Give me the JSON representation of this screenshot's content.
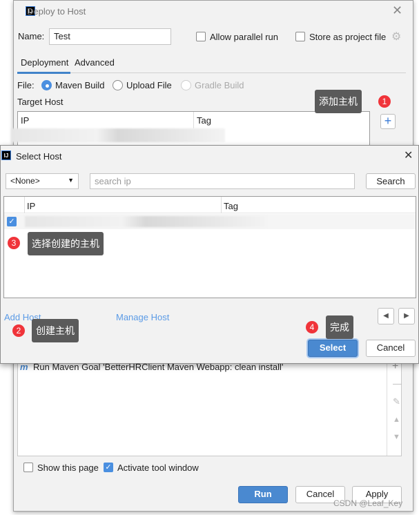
{
  "deploy_dialog": {
    "title": "Deploy to Host",
    "name_label": "Name:",
    "name_value": "Test",
    "allow_parallel": {
      "label": "Allow parallel run",
      "checked": false
    },
    "store_project": {
      "label": "Store as project file",
      "checked": false
    },
    "tabs": [
      {
        "label": "Deployment",
        "active": true
      },
      {
        "label": "Advanced",
        "active": false
      }
    ],
    "file_label": "File:",
    "file_options": [
      {
        "label": "Maven Build",
        "selected": true
      },
      {
        "label": "Upload File",
        "selected": false
      },
      {
        "label": "Gradle Build",
        "selected": false,
        "disabled": true
      }
    ],
    "target_host_label": "Target Host",
    "target_columns": [
      "IP",
      "Tag"
    ],
    "before_launch_item": "Run Maven Goal 'BetterHRClient Maven Webapp: clean install'",
    "show_page": {
      "label": "Show this page",
      "checked": false
    },
    "activate_tool": {
      "label": "Activate tool window",
      "checked": true
    },
    "buttons": {
      "run": "Run",
      "cancel": "Cancel",
      "apply": "Apply"
    }
  },
  "select_host": {
    "title": "Select Host",
    "filter_value": "<None>",
    "search_placeholder": "search ip",
    "search_button": "Search",
    "columns": [
      "IP",
      "Tag"
    ],
    "rows": [
      {
        "checked": true
      }
    ],
    "add_host": "Add Host",
    "manage_host": "Manage Host",
    "select_button": "Select",
    "cancel_button": "Cancel"
  },
  "annotations": [
    {
      "num": "1",
      "text": "添加主机"
    },
    {
      "num": "2",
      "text": "创建主机"
    },
    {
      "num": "3",
      "text": "选择创建的主机"
    },
    {
      "num": "4",
      "text": "完成"
    }
  ],
  "watermark": "CSDN @Leaf_Key",
  "colors": {
    "accent": "#4a89d0",
    "badge": "#f0343a",
    "tooltip": "#5a5a5a",
    "link": "#5b9be6"
  }
}
